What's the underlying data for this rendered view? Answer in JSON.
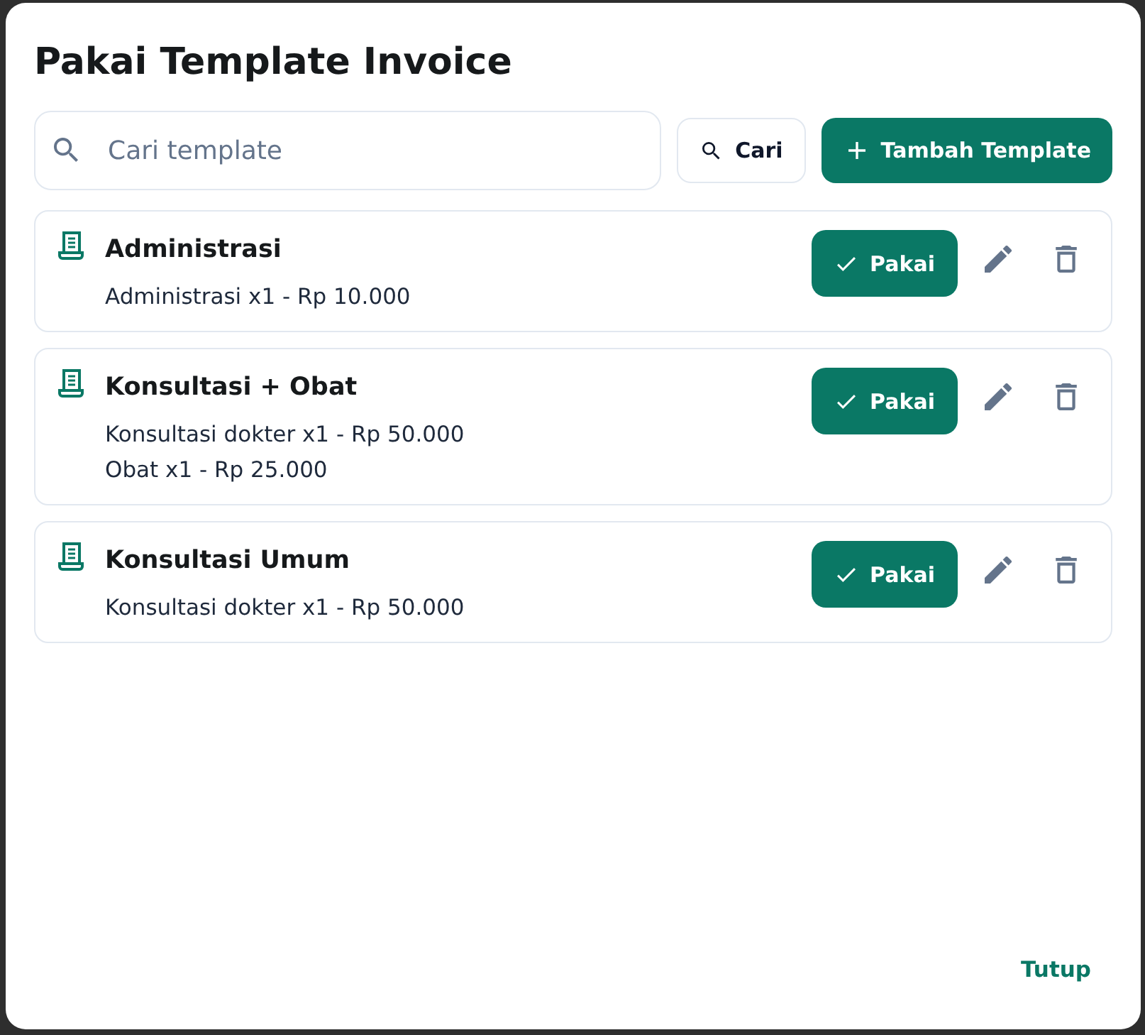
{
  "dialog": {
    "title": "Pakai Template Invoice"
  },
  "search": {
    "placeholder": "Cari template"
  },
  "search_button": {
    "label": "Cari"
  },
  "add_button": {
    "label": "Tambah Template"
  },
  "templates": [
    {
      "name": "Administrasi",
      "items": [
        "Administrasi x1 - Rp 10.000"
      ],
      "use_button": "Pakai"
    },
    {
      "name": "Konsultasi + Obat",
      "items": [
        "Konsultasi dokter x1 - Rp 50.000",
        "Obat x1 - Rp 25.000"
      ],
      "use_button": "Pakai"
    },
    {
      "name": "Konsultasi Umum",
      "items": [
        "Konsultasi dokter x1 - Rp 50.000"
      ],
      "use_button": "Pakai"
    }
  ],
  "close_button": {
    "label": "Tutup"
  }
}
